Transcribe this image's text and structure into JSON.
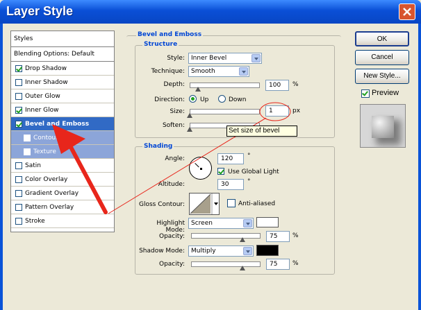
{
  "window": {
    "title": "Layer Style"
  },
  "sidebar": {
    "header": "Styles",
    "blending": "Blending Options: Default",
    "items": [
      {
        "label": "Drop Shadow",
        "checked": true
      },
      {
        "label": "Inner Shadow",
        "checked": false
      },
      {
        "label": "Outer Glow",
        "checked": false
      },
      {
        "label": "Inner Glow",
        "checked": true
      },
      {
        "label": "Bevel and Emboss",
        "checked": true,
        "selected": true
      },
      {
        "label": "Contour",
        "checked": false,
        "sub": true
      },
      {
        "label": "Texture",
        "checked": false,
        "sub": true
      },
      {
        "label": "Satin",
        "checked": false
      },
      {
        "label": "Color Overlay",
        "checked": false
      },
      {
        "label": "Gradient Overlay",
        "checked": false
      },
      {
        "label": "Pattern Overlay",
        "checked": false
      },
      {
        "label": "Stroke",
        "checked": false
      }
    ]
  },
  "bevel": {
    "group_title": "Bevel and Emboss",
    "structure_title": "Structure",
    "style_label": "Style:",
    "style_value": "Inner Bevel",
    "technique_label": "Technique:",
    "technique_value": "Smooth",
    "depth_label": "Depth:",
    "depth_value": "100",
    "depth_unit": "%",
    "direction_label": "Direction:",
    "dir_up": "Up",
    "dir_down": "Down",
    "size_label": "Size:",
    "size_value": "1",
    "size_unit": "px",
    "soften_label": "Soften:",
    "tooltip": "Set size of bevel"
  },
  "shading": {
    "title": "Shading",
    "angle_label": "Angle:",
    "angle_value": "120",
    "angle_unit": "°",
    "global_light": "Use Global Light",
    "altitude_label": "Altitude:",
    "altitude_value": "30",
    "altitude_unit": "°",
    "gloss_label": "Gloss Contour:",
    "anti_aliased": "Anti-aliased",
    "highlight_label": "Highlight Mode:",
    "highlight_value": "Screen",
    "highlight_color": "#ffffff",
    "opacity_label": "Opacity:",
    "highlight_opacity": "75",
    "shadow_label": "Shadow Mode:",
    "shadow_value": "Multiply",
    "shadow_color": "#000000",
    "shadow_opacity": "75",
    "pct": "%"
  },
  "buttons": {
    "ok": "OK",
    "cancel": "Cancel",
    "new_style": "New Style...",
    "preview": "Preview"
  }
}
